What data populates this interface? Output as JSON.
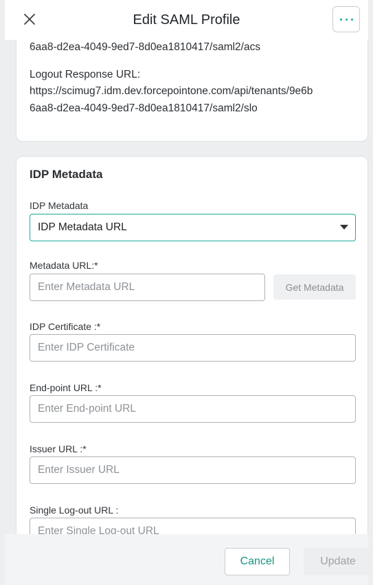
{
  "header": {
    "title": "Edit SAML Profile"
  },
  "sp_info": {
    "acs_url_tail": "6aa8-d2ea-4049-9ed7-8d0ea1810417/saml2/acs",
    "logout_label": "Logout Response URL:",
    "logout_url_line1": "https://scimug7.idm.dev.forcepointone.com/api/tenants/9e6b",
    "logout_url_line2": "6aa8-d2ea-4049-9ed7-8d0ea1810417/saml2/slo"
  },
  "idp": {
    "section_title": "IDP Metadata",
    "metadata_label": "IDP Metadata",
    "metadata_selected": "IDP Metadata URL",
    "metadata_url_label": "Metadata URL:*",
    "metadata_url_placeholder": "Enter Metadata URL",
    "get_metadata_label": "Get Metadata",
    "certificate_label": "IDP Certificate :*",
    "certificate_placeholder": "Enter IDP Certificate",
    "endpoint_label": "End-point URL :*",
    "endpoint_placeholder": "Enter End-point URL",
    "issuer_label": "Issuer URL :*",
    "issuer_placeholder": "Enter Issuer URL",
    "slo_label": "Single Log-out URL :",
    "slo_placeholder": "Enter Single Log-out URL"
  },
  "footer": {
    "cancel_label": "Cancel",
    "update_label": "Update"
  },
  "colors": {
    "accent": "#1aa99a",
    "accent_text": "#16927f",
    "background": "#eceef0"
  },
  "icons": {
    "close": "close-icon",
    "more": "more-horizontal-icon",
    "dropdown": "chevron-down-icon"
  }
}
